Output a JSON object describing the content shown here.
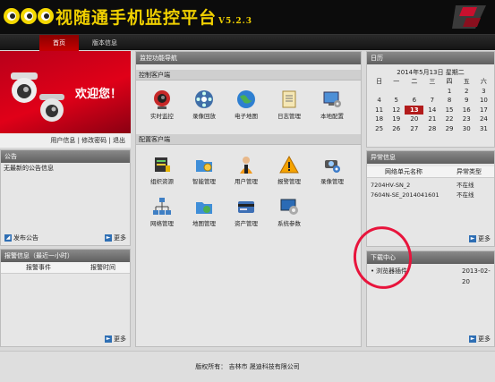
{
  "app": {
    "title": "视随通手机监控平台",
    "version": "V5.2.3"
  },
  "nav": {
    "home": "首页",
    "version_info": "版本信息"
  },
  "banner": {
    "welcome": "欢迎您！"
  },
  "user_links": "用户信息 | 修改密码 | 退出",
  "notice": {
    "title": "公告",
    "empty": "无最新的公告信息",
    "publish": "发布公告",
    "more": "更多"
  },
  "alarm": {
    "title": "报警信息（最近一小时）",
    "col_event": "报警事件",
    "col_time": "报警时间",
    "more": "更多"
  },
  "function_nav": {
    "title": "监控功能导航",
    "control_client": "控制客户端",
    "control_items": [
      "实时监控",
      "录像回放",
      "电子地图",
      "日志管理",
      "本地配置"
    ],
    "config_client": "配置客户端",
    "config_items": [
      "组织资源",
      "智能管理",
      "用户管理",
      "报警管理",
      "录像管理",
      "网络管理",
      "地图管理",
      "资产管理",
      "系统参数"
    ]
  },
  "calendar": {
    "title": "日历",
    "date_line": "2014年5月13日 星期二",
    "weekdays": [
      "日",
      "一",
      "二",
      "三",
      "四",
      "五",
      "六"
    ],
    "weeks": [
      [
        "",
        "",
        "",
        "",
        "1",
        "2",
        "3"
      ],
      [
        "4",
        "5",
        "6",
        "7",
        "8",
        "9",
        "10"
      ],
      [
        "11",
        "12",
        "13",
        "14",
        "15",
        "16",
        "17"
      ],
      [
        "18",
        "19",
        "20",
        "21",
        "22",
        "23",
        "24"
      ],
      [
        "25",
        "26",
        "27",
        "28",
        "29",
        "30",
        "31"
      ]
    ],
    "today": "13"
  },
  "abnormal": {
    "title": "异常信息",
    "col_name": "网络单元名称",
    "col_type": "异常类型",
    "rows": [
      {
        "name": "7204HV-SN_2",
        "type": "不在线"
      },
      {
        "name": "7604N-SE_2014041601",
        "type": "不在线"
      }
    ],
    "more": "更多"
  },
  "download": {
    "title": "下载中心",
    "item": "浏览器插件",
    "date": "2013-02-20",
    "more": "更多"
  },
  "footer": "版权所有：   吉林市 晟迪科技有限公司",
  "colors": {
    "accent_red": "#c40000",
    "title_yellow": "#f0d000",
    "annotation": "#e8143c"
  }
}
